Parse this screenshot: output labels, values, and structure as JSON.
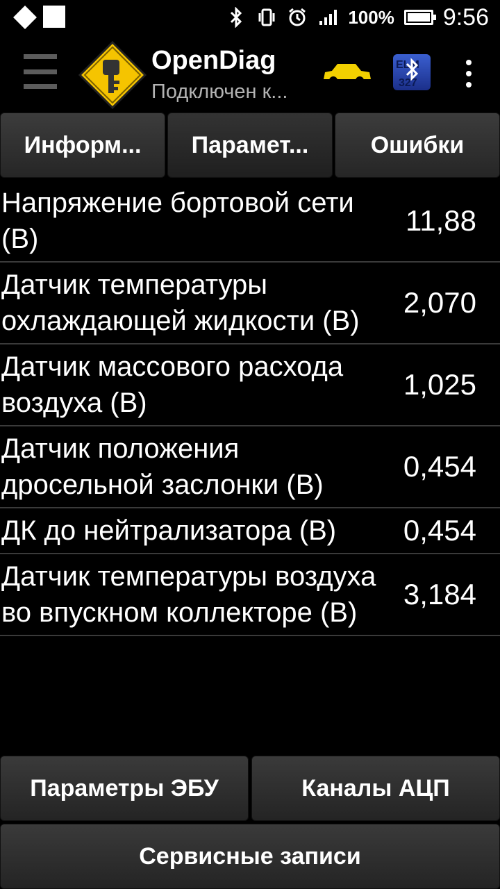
{
  "status_bar": {
    "battery_text": "100%",
    "battery_level": 1.0,
    "time": "9:56",
    "icons": [
      "bluetooth-icon",
      "vibrate-icon",
      "alarm-icon",
      "signal-icon",
      "battery-icon"
    ]
  },
  "app_bar": {
    "title": "OpenDiag",
    "subtitle": "Подключен к...",
    "bt_badge_text": "ELM 327"
  },
  "tabs": [
    {
      "label": "Информ...",
      "active": false
    },
    {
      "label": "Парамет...",
      "active": true
    },
    {
      "label": "Ошибки",
      "active": false
    }
  ],
  "parameters": [
    {
      "label": "Напряжение бортовой сети (В)",
      "value": "11,88"
    },
    {
      "label": "Датчик температуры охлаждающей жидкости (В)",
      "value": "2,070"
    },
    {
      "label": "Датчик массового расхода воздуха (В)",
      "value": "1,025"
    },
    {
      "label": "Датчик положения дросельной заслонки (В)",
      "value": "0,454"
    },
    {
      "label": "ДК до нейтрализатора (В)",
      "value": "0,454"
    },
    {
      "label": "Датчик температуры воздуха во впускном коллекторе (В)",
      "value": "3,184"
    }
  ],
  "buttons": {
    "ecu_params": "Параметры ЭБУ",
    "adc_channels": "Каналы АЦП",
    "service_records": "Сервисные записи"
  },
  "colors": {
    "background": "#000000",
    "logo_yellow": "#f5c400",
    "car_yellow": "#f2d000",
    "badge_blue": "#2f4fc0"
  }
}
